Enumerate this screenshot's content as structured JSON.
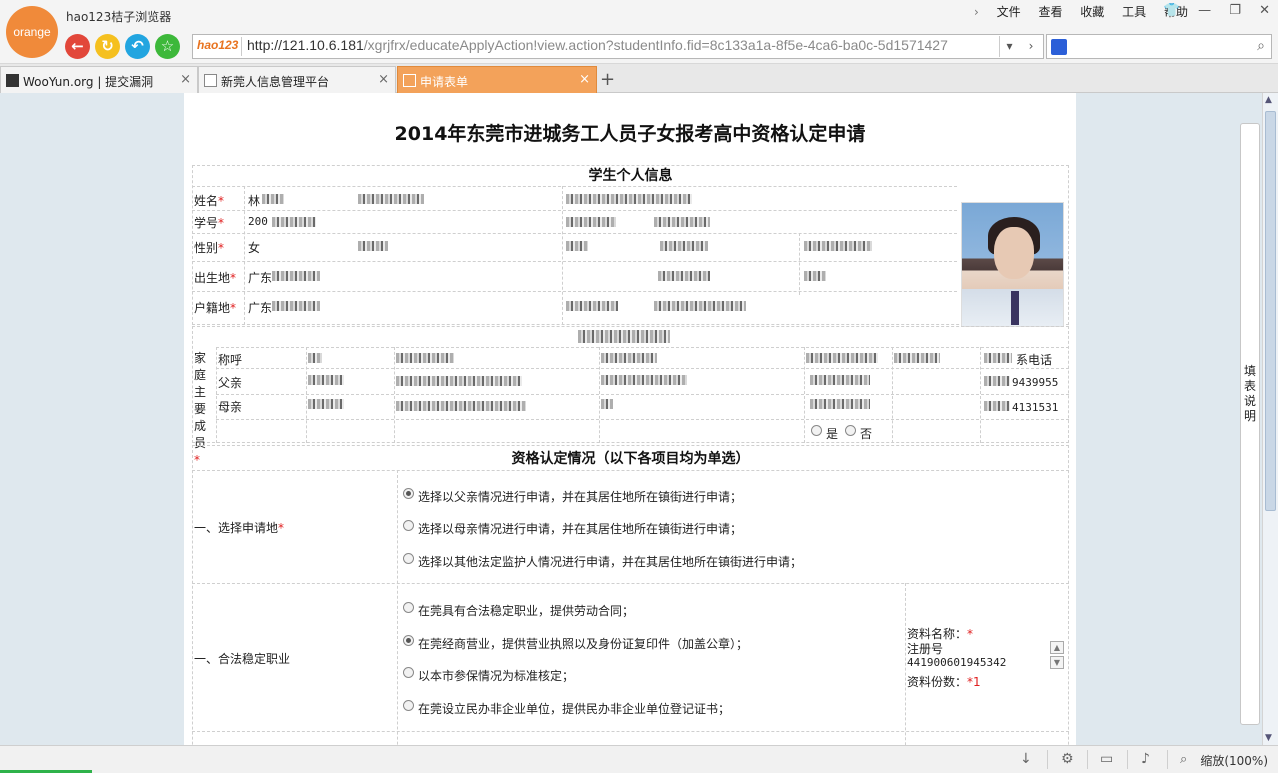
{
  "browser": {
    "logo_text": "orange",
    "app_title": "hao123桔子浏览器",
    "menu": [
      "文件",
      "查看",
      "收藏",
      "工具",
      "帮助"
    ],
    "address_logo": "hao123",
    "address_host": "http://121.10.6.181",
    "address_path": "/xgrjfrx/educateApplyAction!view.action?studentInfo.fid=8c133a1a-8f5e-4ca6-ba0c-5d1571427",
    "search_placeholder": "",
    "tabs": [
      {
        "label": "WooYun.org | 提交漏洞"
      },
      {
        "label": "新莞人信息管理平台"
      },
      {
        "label": "申请表单"
      }
    ],
    "side_help": "填表说明",
    "zoom_label": "缩放(100%)"
  },
  "form": {
    "title": "2014年东莞市进城务工人员子女报考高中资格认定申请",
    "section1": {
      "heading": "学生个人信息",
      "name_label": "姓名",
      "name_value": "林",
      "student_no_label": "学号",
      "student_no_value": "200",
      "gender_label": "性别",
      "gender_value": "女",
      "birthplace_label": "出生地",
      "birthplace_value": "广东",
      "household_label": "户籍地",
      "household_value": "广东"
    },
    "section2": {
      "heading_suffix": "",
      "family_label": "家庭主要成员",
      "relation_header": "称呼",
      "phone_header": "系电话",
      "members": [
        {
          "relation": "父亲",
          "phone": "9439955"
        },
        {
          "relation": "母亲",
          "phone": "4131531"
        }
      ],
      "yes_label": "是",
      "no_label": "否"
    },
    "section3": {
      "heading": "资格认定情况（以下各项目均为单选）",
      "q1_label": "一、选择申请地",
      "q1_options": [
        {
          "text": "选择以父亲情况进行申请，并在其居住地所在镇街进行申请；",
          "checked": true
        },
        {
          "text": "选择以母亲情况进行申请，并在其居住地所在镇街进行申请；",
          "checked": false
        },
        {
          "text": "选择以其他法定监护人情况进行申请，并在其居住地所在镇街进行申请；",
          "checked": false
        }
      ],
      "q2_label": "一、合法稳定职业",
      "q2_options": [
        {
          "text": "在莞具有合法稳定职业，提供劳动合同；",
          "checked": false
        },
        {
          "text": "在莞经商营业，提供营业执照以及身份证复印件（加盖公章）；",
          "checked": true
        },
        {
          "text": "以本市参保情况为标准核定；",
          "checked": false
        },
        {
          "text": "在莞设立民办非企业单位，提供民办非企业单位登记证书；",
          "checked": false
        }
      ],
      "material_name_label": "资料名称：",
      "material_name_value": "注册号",
      "reg_no": "441900601945342",
      "material_count_label": "资料份数：",
      "material_count_value": "1"
    }
  }
}
